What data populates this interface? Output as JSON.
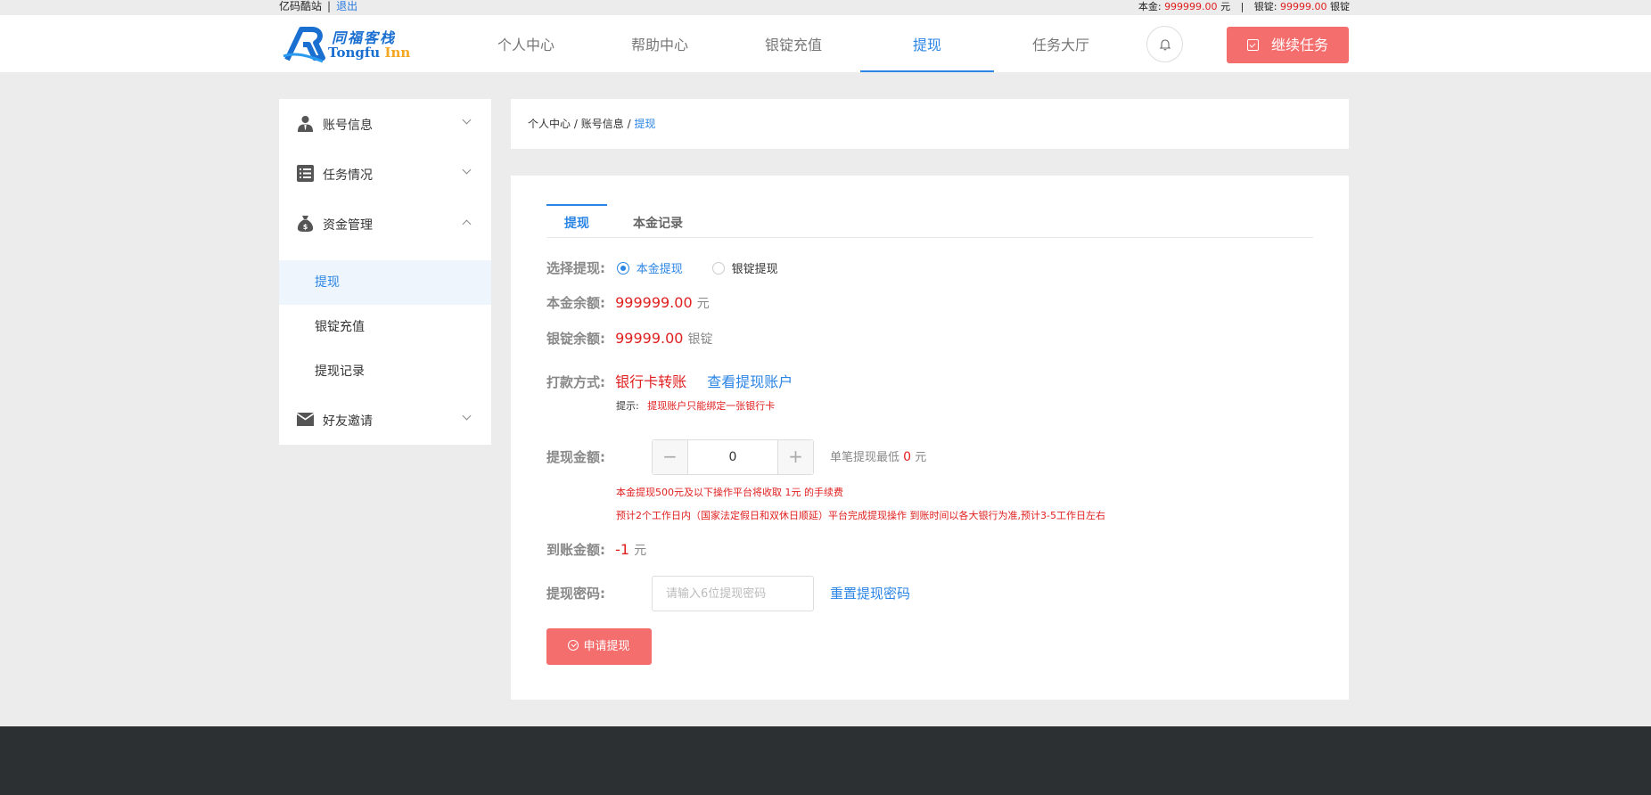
{
  "topbar": {
    "site_name": "亿码酷站",
    "logout": "退出",
    "principal_label": "本金:",
    "principal_value": "999999.00",
    "principal_unit": "元",
    "ingot_label": "银锭:",
    "ingot_value": "99999.00",
    "ingot_unit": "银锭"
  },
  "header": {
    "logo_cn": "同福客栈",
    "logo_en_1": "Tongfu",
    "logo_en_2": "Inn",
    "nav": [
      {
        "label": "个人中心"
      },
      {
        "label": "帮助中心"
      },
      {
        "label": "银锭充值"
      },
      {
        "label": "提现",
        "active": true
      },
      {
        "label": "任务大厅"
      }
    ],
    "continue_btn": "继续任务",
    "bell_icon": "bell-icon"
  },
  "sidebar": {
    "groups": [
      {
        "label": "账号信息",
        "icon": "user-icon"
      },
      {
        "label": "任务情况",
        "icon": "list-icon"
      },
      {
        "label": "资金管理",
        "icon": "money-bag-icon"
      },
      {
        "label": "好友邀请",
        "icon": "envelope-icon"
      }
    ],
    "sub_items": [
      {
        "label": "提现",
        "active": true
      },
      {
        "label": "银锭充值"
      },
      {
        "label": "提现记录"
      }
    ]
  },
  "breadcrumb": {
    "parts": [
      "个人中心",
      "账号信息",
      "提现"
    ],
    "separator": "/"
  },
  "main": {
    "tabs": [
      {
        "label": "提现",
        "active": true
      },
      {
        "label": "本金记录"
      }
    ],
    "select_label": "选择提现:",
    "option_principal": "本金提现",
    "option_ingot": "银锭提现",
    "principal_balance_label": "本金余额:",
    "principal_balance_value": "999999.00",
    "principal_balance_unit": "元",
    "ingot_balance_label": "银锭余额:",
    "ingot_balance_value": "99999.00",
    "ingot_balance_unit": "银锭",
    "payment_label": "打款方式:",
    "payment_value": "银行卡转账",
    "view_account_link": "查看提现账户",
    "tip_label": "提示:",
    "tip_text": "提现账户只能绑定一张银行卡",
    "amount_label": "提现金额:",
    "amount_value": "0",
    "min_text_prefix": "单笔提现最低",
    "min_value": "0",
    "min_unit": "元",
    "fee_note": "本金提现500元及以下操作平台将收取 1元 的手续费",
    "time_note": "预计2个工作日内（国家法定假日和双休日顺延）平台完成提现操作 到账时间以各大银行为准,预计3-5工作日左右",
    "arrival_label": "到账金额:",
    "arrival_value": "-1",
    "arrival_unit": "元",
    "password_label": "提现密码:",
    "password_placeholder": "请输入6位提现密码",
    "reset_password_link": "重置提现密码",
    "submit_btn": "申请提现"
  }
}
